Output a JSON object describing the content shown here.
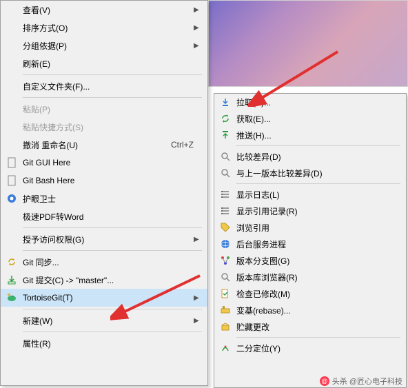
{
  "main_menu": {
    "view": "查看(V)",
    "sort": "排序方式(O)",
    "group": "分组依据(P)",
    "refresh": "刷新(E)",
    "customize": "自定义文件夹(F)...",
    "paste": "粘贴(P)",
    "paste_shortcut": "粘贴快捷方式(S)",
    "undo_rename": "撤消 重命名(U)",
    "undo_key": "Ctrl+Z",
    "git_gui": "Git GUI Here",
    "git_bash": "Git Bash Here",
    "eye_guard": "护眼卫士",
    "pdf2word": "极速PDF转Word",
    "grant_access": "授予访问权限(G)",
    "git_sync": "Git 同步...",
    "git_commit": "Git 提交(C) -> \"master\"...",
    "tortoisegit": "TortoiseGit(T)",
    "new": "新建(W)",
    "properties": "属性(R)"
  },
  "sub_menu": {
    "pull": "拉取(P)...",
    "fetch": "获取(E)...",
    "push": "推送(H)...",
    "diff": "比较差异(D)",
    "diff_prev": "与上一版本比较差异(D)",
    "log": "显示日志(L)",
    "reflog": "显示引用记录(R)",
    "browse_ref": "浏览引用",
    "daemon": "后台服务进程",
    "branch_graph": "版本分支图(G)",
    "repo_browser": "版本库浏览器(R)",
    "check_mods": "检查已修改(M)",
    "rebase": "变基(rebase)...",
    "stash": "贮藏更改",
    "bisect": "二分定位(Y)"
  },
  "footer": {
    "handle": "头杀 @匠心电子科技"
  }
}
